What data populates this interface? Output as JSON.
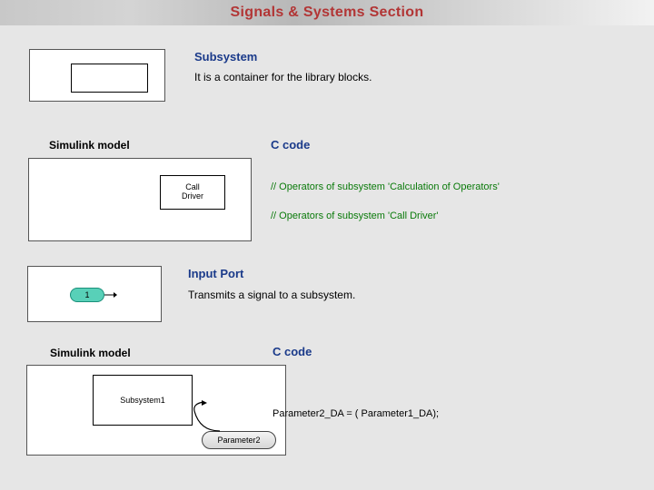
{
  "title": "Signals & Systems Section",
  "subsystem": {
    "heading": "Subsystem",
    "desc": "It is a container for the library blocks."
  },
  "labels": {
    "simulink_model": "Simulink model",
    "c_code": "C code"
  },
  "example1": {
    "block_label": "Call\nDriver",
    "comment1": "// Operators of subsystem 'Calculation of Operators'",
    "comment2": "// Operators of subsystem 'Call Driver'"
  },
  "input_port": {
    "heading": "Input Port",
    "desc": "Transmits a signal to a subsystem.",
    "port_number": "1"
  },
  "example2": {
    "block_label": "Subsystem1",
    "param_label": "Parameter2",
    "code_line": "Parameter2_DA = ( Parameter1_DA);"
  }
}
